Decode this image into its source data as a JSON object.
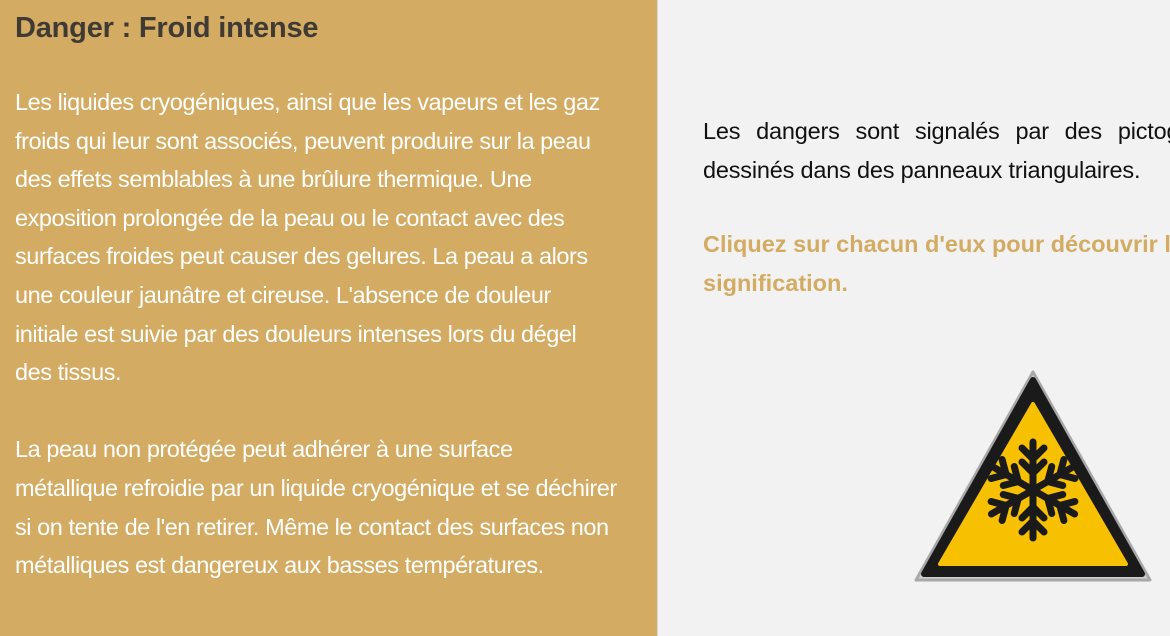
{
  "left_panel": {
    "title": "Danger : Froid intense",
    "paragraph_1": "Les liquides cryogéniques, ainsi que les vapeurs et les gaz froids qui leur sont associés, peuvent produire sur la peau des effets semblables à une brûlure thermique. Une exposition prolongée de la peau ou le contact avec des surfaces froides peut causer des gelures. La peau a alors une couleur jaunâtre et cireuse. L'absence de douleur initiale est suivie par des douleurs intenses lors du dégel des tissus.",
    "paragraph_2": "La peau non protégée peut adhérer à une surface métallique refroidie par un liquide cryogénique et se déchirer si on tente de l'en retirer. Même le contact des surfaces non métalliques est dangereux aux basses températures."
  },
  "right_panel": {
    "intro": "Les dangers sont signalés par des pictogrammes dessinés dans des panneaux triangulaires.",
    "cta": "Cliquez sur chacun d'eux pour découvrir leur signification.",
    "sign_icon": "cold-hazard-warning-sign-icon"
  },
  "colors": {
    "panel_background": "#d4ab62",
    "title_text": "#403a35",
    "cta_text": "#d4ab62",
    "sign_yellow": "#f7c000",
    "sign_black": "#1a1a1a"
  }
}
